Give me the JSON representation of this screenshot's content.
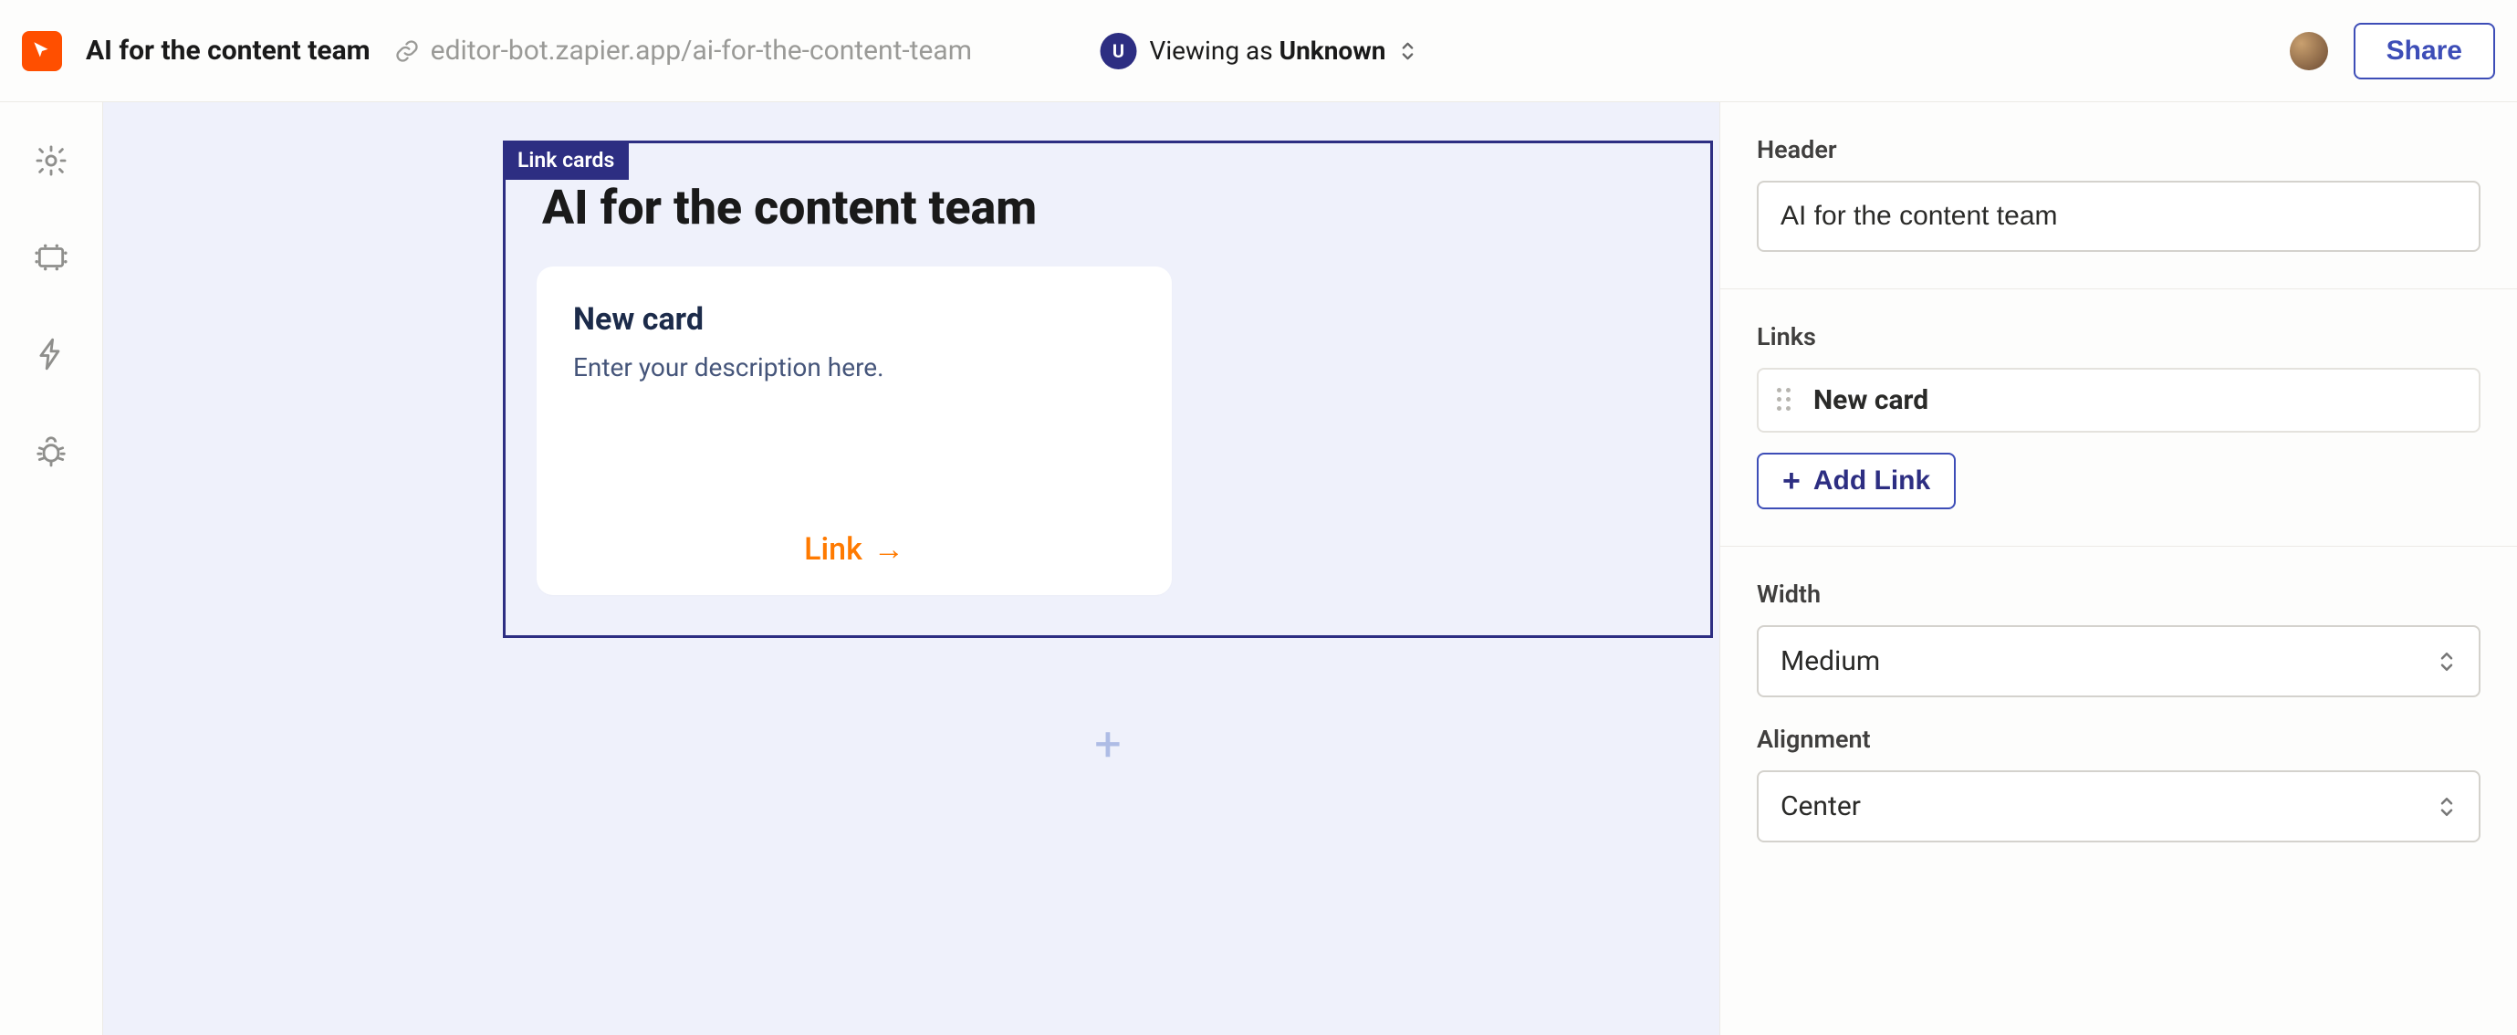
{
  "topbar": {
    "title": "AI for the content team",
    "url": "editor-bot.zapier.app/ai-for-the-content-team",
    "viewer": {
      "badge": "U",
      "prefix": "Viewing as ",
      "name": "Unknown"
    },
    "share_label": "Share"
  },
  "rail": {
    "items": [
      {
        "name": "settings"
      },
      {
        "name": "layout"
      },
      {
        "name": "actions"
      },
      {
        "name": "debug"
      }
    ]
  },
  "canvas": {
    "block_tag": "Link cards",
    "heading": "AI for the content team",
    "card": {
      "title": "New card",
      "description": "Enter your description here.",
      "link_label": "Link"
    }
  },
  "panel": {
    "header": {
      "label": "Header",
      "value": "AI for the content team"
    },
    "links": {
      "label": "Links",
      "items": [
        "New card"
      ],
      "add_label": "Add Link"
    },
    "width": {
      "label": "Width",
      "value": "Medium"
    },
    "alignment": {
      "label": "Alignment",
      "value": "Center"
    }
  }
}
